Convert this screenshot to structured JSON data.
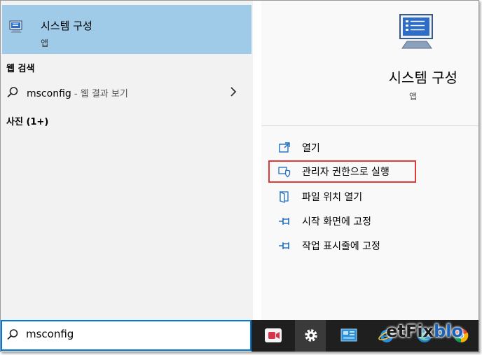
{
  "best_match": {
    "title": "시스템 구성",
    "subtitle": "앱",
    "icon": "system-configuration-icon"
  },
  "sections": {
    "web": "웹 검색",
    "photos": "사진 (1+)"
  },
  "web_result": {
    "query": "msconfig",
    "suffix": " - 웹 결과 보기"
  },
  "detail": {
    "title": "시스템 구성",
    "subtitle": "앱",
    "actions": [
      {
        "label": "열기",
        "icon": "open-icon"
      },
      {
        "label": "관리자 권한으로 실행",
        "icon": "shield-icon",
        "highlighted": true
      },
      {
        "label": "파일 위치 열기",
        "icon": "folder-icon"
      },
      {
        "label": "시작 화면에 고정",
        "icon": "pin-icon"
      },
      {
        "label": "작업 표시줄에 고정",
        "icon": "pin-icon"
      }
    ]
  },
  "search": {
    "value": "msconfig"
  },
  "watermark": {
    "text_dark": "etFix",
    "text_blue": "blo"
  },
  "colors": {
    "selection": "#9fcbe8",
    "accent": "#0078d7",
    "highlight_border": "#e03a3a",
    "taskbar": "#1f1f1f"
  }
}
